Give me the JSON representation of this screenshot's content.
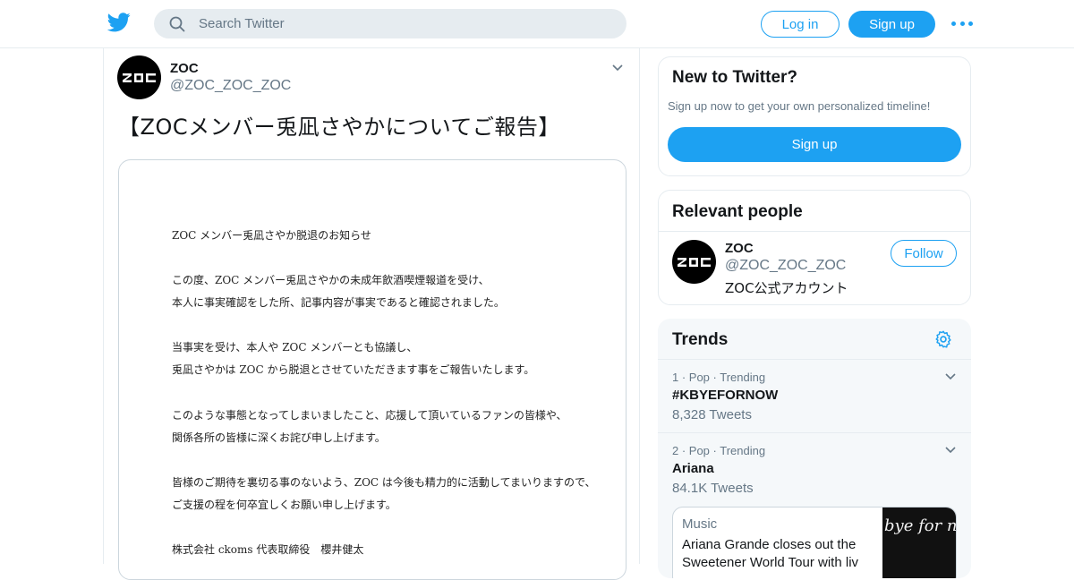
{
  "header": {
    "search_placeholder": "Search Twitter",
    "login_label": "Log in",
    "signup_label": "Sign up",
    "brand_color": "#1da1f2"
  },
  "tweet": {
    "name": "ZOC",
    "handle": "@ZOC_ZOC_ZOC",
    "text": "【ZOCメンバー兎凪さやかについてご報告】",
    "document_lines": [
      "ZOC メンバー兎凪さやか脱退のお知らせ",
      "この度、ZOC メンバー兎凪さやかの未成年飲酒喫煙報道を受け、",
      "本人に事実確認をした所、記事内容が事実であると確認されました。",
      "当事実を受け、本人や ZOC メンバーとも協議し、",
      "兎凪さやかは ZOC から脱退とさせていただきます事をご報告いたします。",
      "このような事態となってしまいましたこと、応援して頂いているファンの皆様や、",
      "関係各所の皆様に深くお詫び申し上げます。",
      "皆様のご期待を裏切る事のないよう、ZOC は今後も精力的に活動してまいりますので、",
      "ご支援の程を何卒宜しくお願い申し上げます。",
      "株式会社 ckoms 代表取締役　櫻井健太"
    ]
  },
  "new_to_twitter": {
    "title": "New to Twitter?",
    "subtitle": "Sign up now to get your own personalized timeline!",
    "signup_label": "Sign up"
  },
  "relevant_people": {
    "title": "Relevant people",
    "person": {
      "name": "ZOC",
      "handle": "@ZOC_ZOC_ZOC",
      "bio": "ZOC公式アカウント",
      "follow_label": "Follow"
    }
  },
  "trends": {
    "title": "Trends",
    "items": [
      {
        "meta": "1 · Pop · Trending",
        "name": "#KBYEFORNOW",
        "count": "8,328 Tweets"
      },
      {
        "meta": "2 · Pop · Trending",
        "name": "Ariana",
        "count": "84.1K Tweets"
      }
    ],
    "news": {
      "category": "Music",
      "headline": "Ariana Grande closes out the Sweetener World Tour with liv",
      "thumb_text": "bye for n"
    }
  }
}
